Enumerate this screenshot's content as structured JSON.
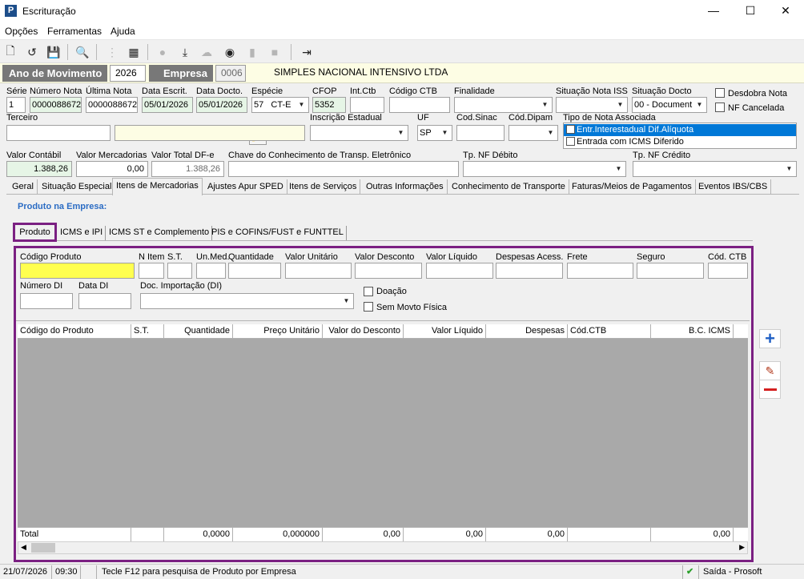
{
  "window": {
    "title": "Escrituração",
    "minimize": "—",
    "maximize": "☐",
    "close": "✕"
  },
  "menu": [
    "Opções",
    "Ferramentas",
    "Ajuda"
  ],
  "header": {
    "ano_label": "Ano de Movimento",
    "ano_value": "2026",
    "empresa_label": "Empresa",
    "empresa_code": "0006",
    "empresa_name": "SIMPLES NACIONAL INTENSIVO LTDA"
  },
  "form": {
    "serie": {
      "label": "Série",
      "value": "1"
    },
    "numero_nota": {
      "label": "Número Nota",
      "value": "0000088672"
    },
    "ultima_nota": {
      "label": "Última Nota",
      "value": "0000088672"
    },
    "data_escrit": {
      "label": "Data Escrit.",
      "value": "05/01/2026"
    },
    "data_docto": {
      "label": "Data Docto.",
      "value": "05/01/2026"
    },
    "especie": {
      "label": "Espécie",
      "code": "57",
      "value": "CT-E"
    },
    "cfop": {
      "label": "CFOP",
      "value": "5352"
    },
    "int_ctb": {
      "label": "Int.Ctb",
      "value": ""
    },
    "codigo_ctb": {
      "label": "Código CTB",
      "value": ""
    },
    "finalidade": {
      "label": "Finalidade",
      "value": ""
    },
    "situacao_iss": {
      "label": "Situação Nota ISS",
      "value": ""
    },
    "situacao_docto": {
      "label": "Situação Docto",
      "value": "00 - Document"
    },
    "desdobra": {
      "label": "Desdobra Nota"
    },
    "nf_cancelada": {
      "label": "NF Cancelada"
    },
    "terceiro": {
      "label": "Terceiro",
      "value": ""
    },
    "inscricao": {
      "label": "Inscrição Estadual",
      "value": ""
    },
    "uf": {
      "label": "UF",
      "value": "SP"
    },
    "cod_sinac": {
      "label": "Cod.Sinac",
      "value": ""
    },
    "cod_dipam": {
      "label": "Cód.Dipam",
      "value": ""
    },
    "tipo_nota": {
      "label": "Tipo de Nota Associada",
      "options": [
        "Entr.Interestadual Dif.Alíquota",
        "Entrada com ICMS Diferido"
      ]
    },
    "valor_contabil": {
      "label": "Valor Contábil",
      "value": "1.388,26"
    },
    "valor_mercadorias": {
      "label": "Valor Mercadorias",
      "value": "0,00"
    },
    "valor_total_dfe": {
      "label": "Valor Total DF-e",
      "value": "1.388,26"
    },
    "chave": {
      "label": "Chave do Conhecimento de Transp. Eletrônico",
      "value": ""
    },
    "tp_nf_debito": {
      "label": "Tp. NF Débito",
      "value": ""
    },
    "tp_nf_credito": {
      "label": "Tp. NF Crédito",
      "value": ""
    }
  },
  "tabs": [
    "Geral",
    "Situação Especial",
    "Itens de Mercadorias",
    "Ajustes Apur SPED",
    "Itens de Serviços",
    "Outras Informações",
    "Conhecimento de Transporte",
    "Faturas/Meios de Pagamentos",
    "Eventos IBS/CBS"
  ],
  "produto_label": "Produto na Empresa:",
  "subtabs": [
    "Produto",
    "ICMS e IPI",
    "ICMS ST e Complemento",
    "PIS e COFINS/FUST e FUNTTEL"
  ],
  "item": {
    "codigo_produto": "Código Produto",
    "n_item": "N Item",
    "st": "S.T.",
    "un_med": "Un.Med.",
    "quantidade": "Quantidade",
    "valor_unitario": "Valor Unitário",
    "valor_desconto": "Valor Desconto",
    "valor_liquido": "Valor Líquido",
    "despesas": "Despesas Acess.",
    "frete": "Frete",
    "seguro": "Seguro",
    "cod_ctb": "Cód. CTB",
    "numero_di": "Número DI",
    "data_di": "Data DI",
    "doc_importacao": "Doc. Importação (DI)",
    "doacao": "Doação",
    "sem_movto": "Sem Movto Física"
  },
  "grid": {
    "columns": [
      "Código do Produto",
      "S.T.",
      "Quantidade",
      "Preço Unitário",
      "Valor do Desconto",
      "Valor Líquido",
      "Despesas",
      "Cód.CTB",
      "B.C. ICMS"
    ],
    "totals": [
      "Total",
      "",
      "0,0000",
      "0,000000",
      "0,00",
      "0,00",
      "0,00",
      "",
      "0,00"
    ]
  },
  "status": {
    "date": "21/07/2026",
    "time": "09:30",
    "hint": "Tecle F12 para pesquisa de Produto por Empresa",
    "mode": "Saída - Prosoft"
  }
}
